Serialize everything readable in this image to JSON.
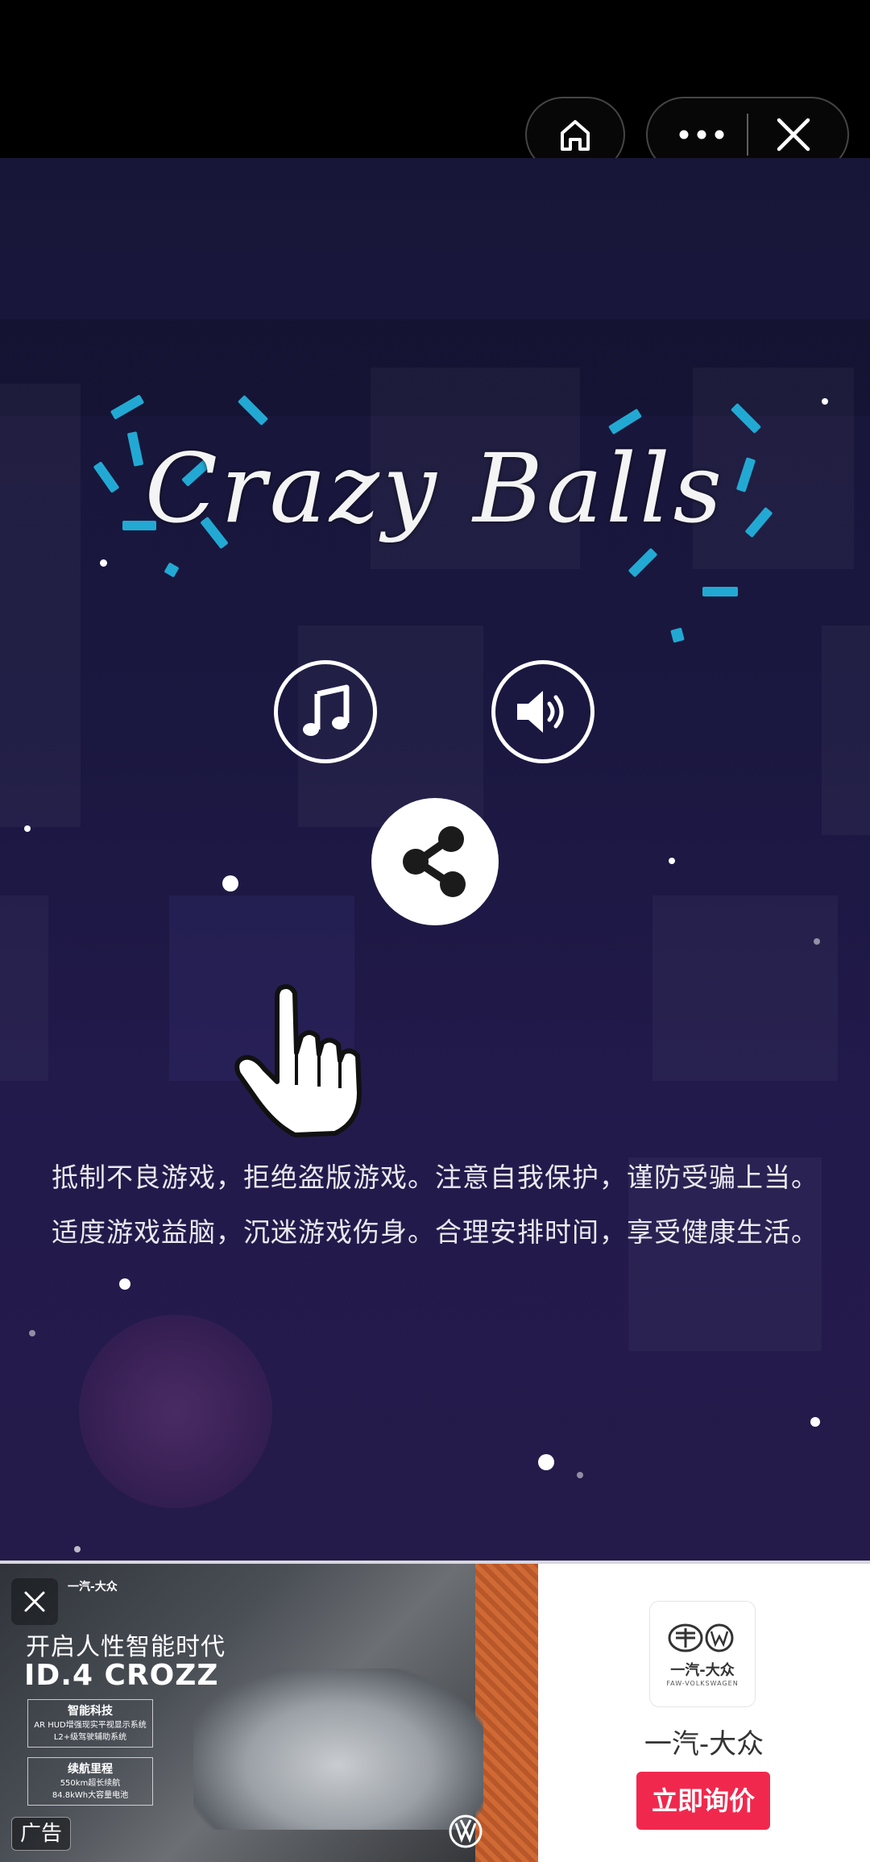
{
  "mini_program_capsule": {
    "home_icon": "home-icon",
    "more_icon": "more-dots-icon",
    "close_icon": "close-icon"
  },
  "game": {
    "title": "Crazy Balls",
    "buttons": {
      "music_icon": "music-note-icon",
      "sound_icon": "speaker-icon",
      "share_icon": "share-icon"
    },
    "hint_icon": "pointing-hand-icon",
    "notice_line1": "抵制不良游戏，拒绝盗版游戏。注意自我保护，谨防受骗上当。",
    "notice_line2": "适度游戏益脑，沉迷游戏伤身。合理安排时间，享受健康生活。"
  },
  "ad": {
    "brand_line": "一汽-大众",
    "slogan": "开启人性智能时代",
    "model": "ID.4 CROZZ",
    "feature1_title": "智能科技",
    "feature1_line1": "AR HUD增强现实平视显示系统",
    "feature1_line2": "L2+级驾驶辅助系统",
    "feature2_title": "续航里程",
    "feature2_line1": "550km超长续航",
    "feature2_line2": "84.8kWh大容量电池",
    "ad_tag": "广告",
    "brand_logo_text": "一汽-大众",
    "brand_logo_sub": "FAW-VOLKSWAGEN",
    "brand_name": "一汽-大众",
    "cta_label": "立即询价",
    "cta_color": "#f1284e"
  }
}
